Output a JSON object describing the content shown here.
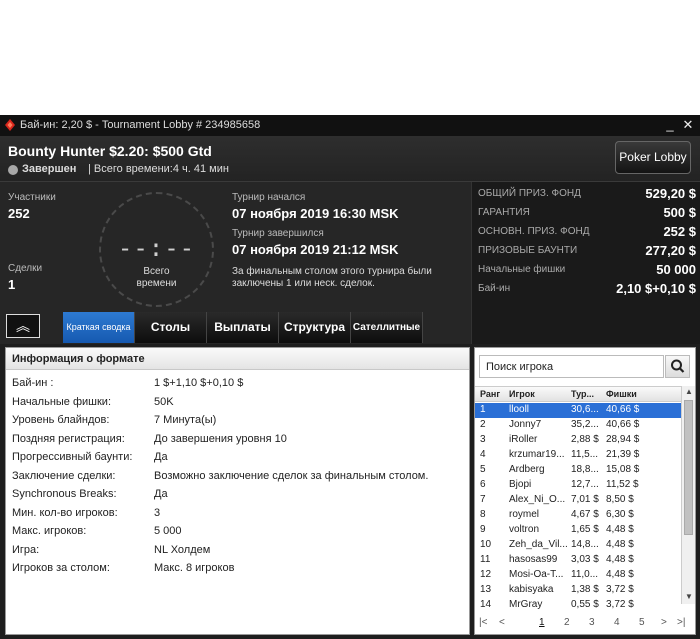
{
  "window": {
    "title": "Бай-ин: 2,20 $ - Tournament Lobby # 234985658",
    "minimize": "_",
    "close": "✕"
  },
  "header": {
    "tournament_name": "Bounty Hunter $2.20: $500 Gtd",
    "status": "Завершен",
    "total_time": "| Всего времени:4 ч. 41 мин",
    "lobby_button": "Poker Lobby"
  },
  "summary": {
    "participants_label": "Участники",
    "participants_value": "252",
    "deals_label": "Сделки",
    "deals_value": "1",
    "clock_digits": "--:--",
    "clock_label_1": "Всего",
    "clock_label_2": "времени",
    "started_label": "Турнир начался",
    "started_value": "07 ноября 2019  16:30 MSK",
    "finished_label": "Турнир завершился",
    "finished_value": "07 ноября 2019  21:12 MSK",
    "note": "За финальным столом этого турнира были заключены 1 или неск. сделок."
  },
  "prize_panel": [
    {
      "label": "ОБЩИЙ ПРИЗ. ФОНД",
      "value": "529,20 $"
    },
    {
      "label": "ГАРАНТИЯ",
      "value": "500 $"
    },
    {
      "label": "ОСНОВН. ПРИЗ. ФОНД",
      "value": "252 $"
    },
    {
      "label": "ПРИЗОВЫЕ БАУНТИ",
      "value": "277,20 $"
    },
    {
      "label": "Начальные фишки",
      "value": "50 000"
    },
    {
      "label": "Бай-ин",
      "value": "2,10 $+0,10 $"
    }
  ],
  "tabs": {
    "collapse": "︽",
    "summary": "Краткая сводка",
    "tables": "Столы",
    "payouts": "Выплаты",
    "structure": "Структура",
    "satellites": "Сателлитные"
  },
  "format": {
    "title": "Информация о формате",
    "rows": [
      {
        "k": "Бай-ин :",
        "v": "1 $+1,10 $+0,10 $"
      },
      {
        "k": "Начальные фишки:",
        "v": "50K"
      },
      {
        "k": "Уровень блайндов:",
        "v": "7 Минута(ы)"
      },
      {
        "k": "Поздняя регистрация:",
        "v": "До завершения уровня 10"
      },
      {
        "k": "Прогрессивный баунти:",
        "v": "Да"
      },
      {
        "k": "Заключение сделки:",
        "v": "Возможно заключение сделок за финальным столом."
      },
      {
        "k": "Synchronous Breaks:",
        "v": "Да"
      },
      {
        "k": "Мин. кол-во игроков:",
        "v": "3"
      },
      {
        "k": "Макс. игроков:",
        "v": "5 000"
      },
      {
        "k": "Игра:",
        "v": "NL Холдем"
      },
      {
        "k": "Игроков за столом:",
        "v": "Макс. 8 игроков"
      }
    ]
  },
  "players": {
    "search_placeholder": "Поиск игрока",
    "headers": {
      "rank": "Ранг",
      "player": "Игрок",
      "tour": "Тур...",
      "chips": "Фишки"
    },
    "rows": [
      {
        "rank": "1",
        "name": "llooll",
        "tour": "30,6...",
        "chips": "40,66 $"
      },
      {
        "rank": "2",
        "name": "Jonny7",
        "tour": "35,2...",
        "chips": "40,66 $"
      },
      {
        "rank": "3",
        "name": "iRoller",
        "tour": "2,88 $",
        "chips": "28,94 $"
      },
      {
        "rank": "4",
        "name": "krzumar19...",
        "tour": "11,5...",
        "chips": "21,39 $"
      },
      {
        "rank": "5",
        "name": "Ardberg",
        "tour": "18,8...",
        "chips": "15,08 $"
      },
      {
        "rank": "6",
        "name": "Bjopi",
        "tour": "12,7...",
        "chips": "11,52 $"
      },
      {
        "rank": "7",
        "name": "Alex_Ni_O...",
        "tour": "7,01 $",
        "chips": "8,50 $"
      },
      {
        "rank": "8",
        "name": "roymel",
        "tour": "4,67 $",
        "chips": "6,30 $"
      },
      {
        "rank": "9",
        "name": "voltron",
        "tour": "1,65 $",
        "chips": "4,48 $"
      },
      {
        "rank": "10",
        "name": "Zeh_da_Vil...",
        "tour": "14,8...",
        "chips": "4,48 $"
      },
      {
        "rank": "11",
        "name": "hasosas99",
        "tour": "3,03 $",
        "chips": "4,48 $"
      },
      {
        "rank": "12",
        "name": "Mosi-Oa-T...",
        "tour": "11,0...",
        "chips": "4,48 $"
      },
      {
        "rank": "13",
        "name": "kabisyaka",
        "tour": "1,38 $",
        "chips": "3,72 $"
      },
      {
        "rank": "14",
        "name": "MrGray",
        "tour": "0,55 $",
        "chips": "3,72 $"
      }
    ],
    "pages": [
      "1",
      "2",
      "3",
      "4",
      "5"
    ],
    "current_page": "1"
  },
  "colors": {
    "accent": "#2a6fd6",
    "window_bg": "#1e1e1e",
    "logo_red": "#d8261c"
  }
}
